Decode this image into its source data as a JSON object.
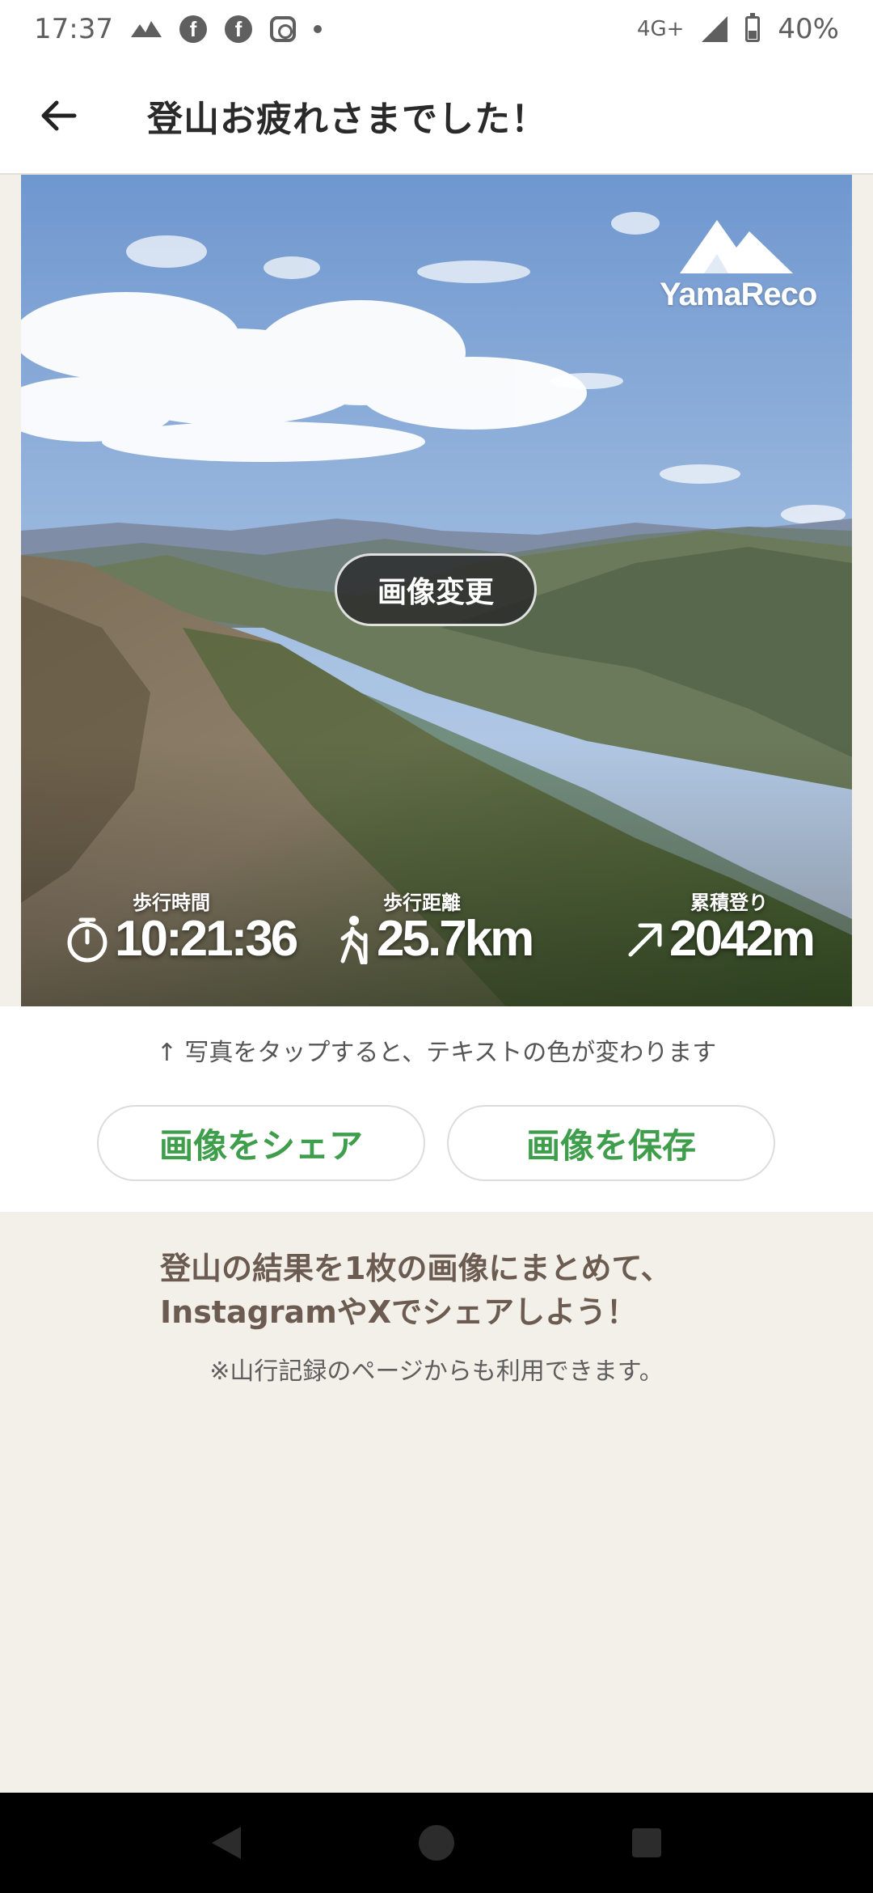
{
  "status_bar": {
    "time": "17:37",
    "network": "4G+",
    "battery": "40%",
    "battery_level": 0.4,
    "icons": [
      "yamap-icon",
      "facebook-icon",
      "facebook-icon",
      "instagram-icon",
      "more-dot-icon",
      "signal-icon",
      "battery-icon"
    ]
  },
  "header": {
    "title": "登山お疲れさまでした！",
    "back_icon": "arrow-left-icon"
  },
  "card": {
    "logo_text": "YamaReco",
    "change_image_label": "画像変更",
    "stats": [
      {
        "label": "歩行時間",
        "value": "10:21:36",
        "icon": "stopwatch-icon"
      },
      {
        "label": "歩行距離",
        "value": "25.7km",
        "icon": "hiker-icon"
      },
      {
        "label": "累積登り",
        "value": "2042m",
        "icon": "arrow-up-right-icon"
      }
    ]
  },
  "hint": "↑ 写真をタップすると、テキストの色が変わります",
  "buttons": {
    "share_label": "画像をシェア",
    "save_label": "画像を保存"
  },
  "info": {
    "line1": "登山の結果を1枚の画像にまとめて、",
    "line2": "InstagramやXでシェアしよう！",
    "note": "※山行記録のページからも利用できます。"
  },
  "colors": {
    "accent_green": "#3f9e4b",
    "promo_brown": "#6b5b50",
    "background": "#f3f0ea"
  }
}
